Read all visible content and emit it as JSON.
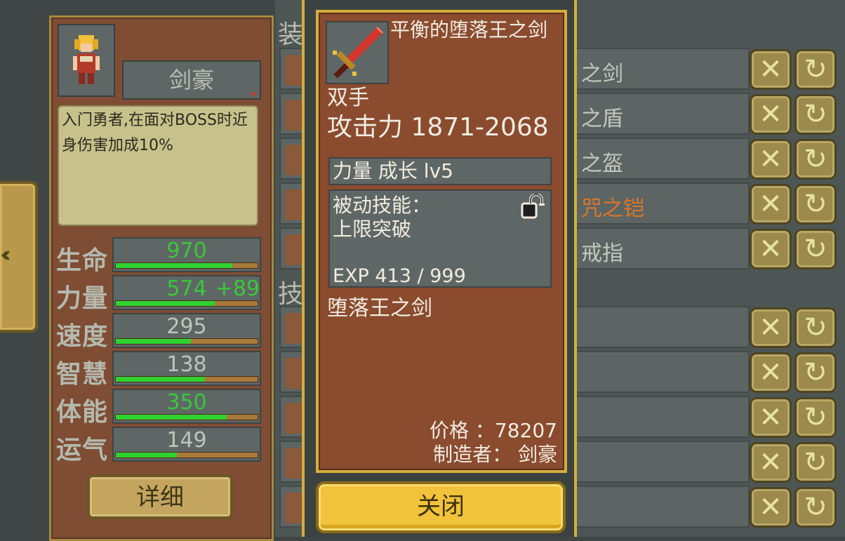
{
  "character": {
    "class_name": "剑豪",
    "description": "入门勇者,在面对BOSS时近身伤害加成10%",
    "detail_button": "详细"
  },
  "stats": [
    {
      "label": "生命",
      "value": "970",
      "bonus": "",
      "bar": 0.82,
      "green": true
    },
    {
      "label": "力量",
      "value": "574",
      "bonus": "+89",
      "bar": 0.7,
      "green": true
    },
    {
      "label": "速度",
      "value": "295",
      "bonus": "",
      "bar": 0.53,
      "green": false
    },
    {
      "label": "智慧",
      "value": "138",
      "bonus": "",
      "bar": 0.63,
      "green": false
    },
    {
      "label": "体能",
      "value": "350",
      "bonus": "",
      "bar": 0.78,
      "green": true
    },
    {
      "label": "运气",
      "value": "149",
      "bonus": "",
      "bar": 0.43,
      "green": false
    }
  ],
  "sections": {
    "equipment_head": "装",
    "skills_head": "技"
  },
  "equipment_rows": [
    {
      "name": "之剑",
      "orange": false
    },
    {
      "name": "之盾",
      "orange": false
    },
    {
      "name": "之盔",
      "orange": false
    },
    {
      "name": "咒之铠",
      "orange": true
    },
    {
      "name": "戒指",
      "orange": false
    }
  ],
  "skill_rows": [
    {
      "name": ""
    },
    {
      "name": ""
    },
    {
      "name": ""
    },
    {
      "name": ""
    },
    {
      "name": ""
    }
  ],
  "item": {
    "title": "平衡的堕落王之剑",
    "hand": "双手",
    "attack": "攻击力 1871-2068",
    "growth": "力量 成长 lv5",
    "passive_label": "被动技能：",
    "passive_name": "上限突破",
    "exp": "EXP 413 / 999",
    "set_name": "堕落王之剑",
    "price": "价格 ：78207",
    "maker": "制造者： 剑豪",
    "close_button": "关闭"
  },
  "icons": {
    "back": "back-arrows-icon",
    "remove": "x-icon",
    "swap": "swap-icon",
    "lock": "lock-icon"
  },
  "colors": {
    "panel": "#7e4d34",
    "popup_card": "#8a4b2f",
    "gold_border": "#d4ad3c",
    "green_bar": "#2fd32f",
    "close_button": "#f1c33a"
  }
}
